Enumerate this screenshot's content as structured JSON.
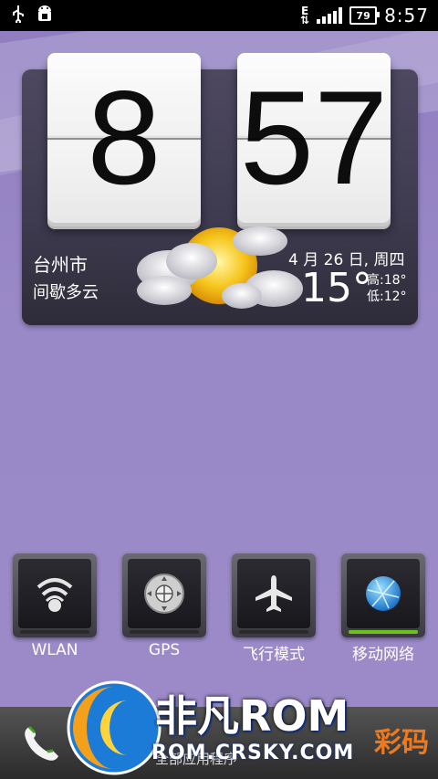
{
  "status_bar": {
    "icons_left": [
      "usb-icon",
      "android-debug-icon"
    ],
    "network_type": "E",
    "battery": "79",
    "time": "8:57"
  },
  "clock": {
    "hour": "8",
    "minute": "57"
  },
  "weather": {
    "city": "台州市",
    "condition": "间歇多云",
    "date": "4 月 26 日, 周四",
    "temperature": "15°",
    "high": "高:18°",
    "low": "低:12°"
  },
  "toggles": [
    {
      "label": "WLAN",
      "icon": "wifi-icon",
      "on": false
    },
    {
      "label": "GPS",
      "icon": "gps-icon",
      "on": false
    },
    {
      "label": "飞行模式",
      "icon": "airplane-icon",
      "on": false
    },
    {
      "label": "移动网络",
      "icon": "globe-icon",
      "on": true
    }
  ],
  "dock": {
    "label": "全部应用程序",
    "phone_icon": "phone-icon"
  },
  "watermark": {
    "title": "非凡ROM",
    "url": "ROM.CRSKY.COM",
    "side": "彩码"
  },
  "colors": {
    "wallpaper": "#9a88c4",
    "accent_green": "#6bc21f"
  }
}
